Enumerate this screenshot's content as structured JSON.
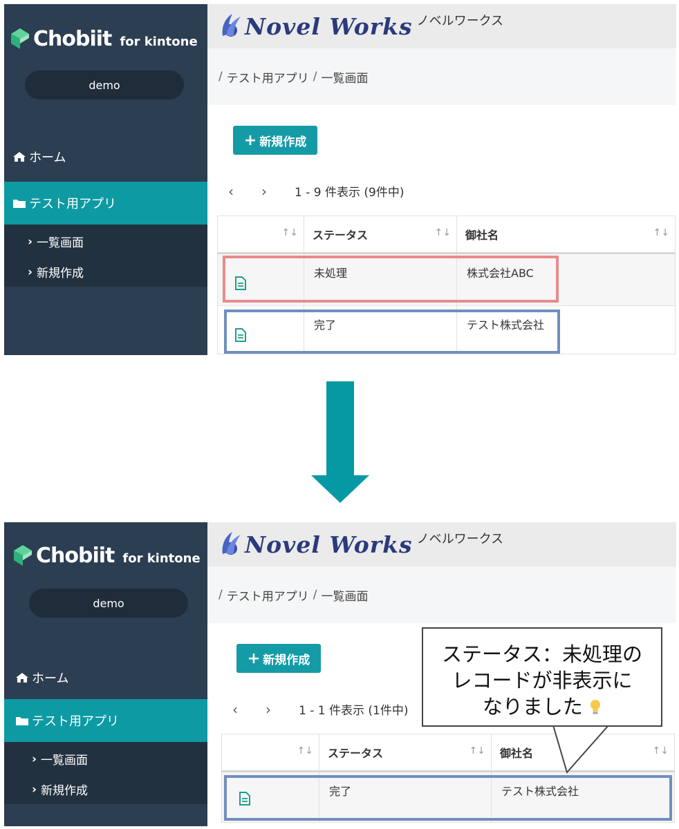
{
  "sidebar": {
    "brand": "Chobiit",
    "brand_sub": "for kintone",
    "user": "demo",
    "home_label": "ホーム",
    "app_label": "テスト用アプリ",
    "sub_items": [
      "一覧画面",
      "新規作成"
    ]
  },
  "header": {
    "logo_text": "Novel Works",
    "logo_kana": "ノベルワークス"
  },
  "breadcrumb": {
    "items": [
      "テスト用アプリ",
      "一覧画面"
    ]
  },
  "new_button_label": "新規作成",
  "table": {
    "columns": [
      "ステータス",
      "御社名"
    ]
  },
  "before": {
    "pager_text": "1 - 9 件表示 (9件中)",
    "rows": [
      {
        "status": "未処理",
        "company": "株式会社ABC"
      },
      {
        "status": "完了",
        "company": "テスト株式会社"
      }
    ]
  },
  "after": {
    "pager_text": "1 - 1 件表示 (1件中)",
    "rows": [
      {
        "status": "完了",
        "company": "テスト株式会社"
      }
    ]
  },
  "callout": {
    "lines": [
      "ステータス：未処理の",
      "レコードが非表示に",
      "なりました"
    ]
  },
  "colors": {
    "sidebar": "#2c3e51",
    "accent": "#0e9aa3",
    "arrow": "#0799a3",
    "highlight_red": "#ea8a8a",
    "highlight_blue": "#6f8fbd"
  }
}
